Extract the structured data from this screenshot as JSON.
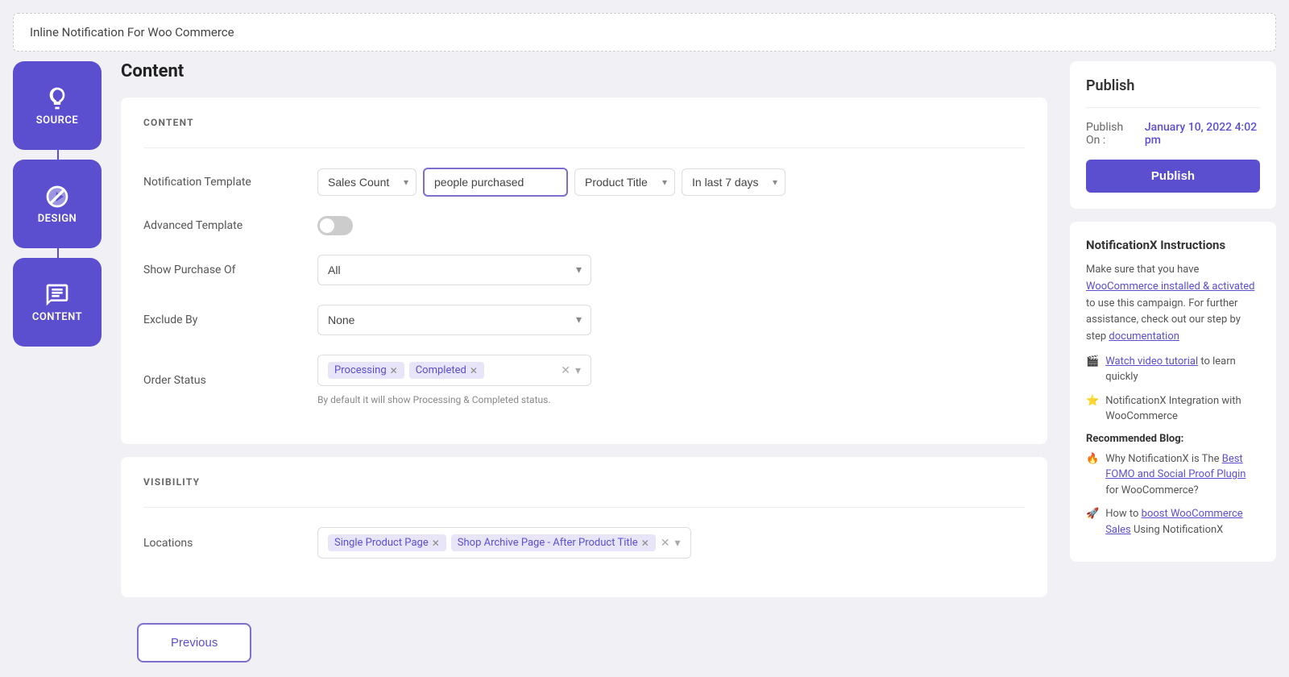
{
  "titleBar": {
    "text": "Inline Notification For Woo Commerce"
  },
  "sidebar": {
    "items": [
      {
        "id": "source",
        "label": "SOURCE",
        "icon": "source"
      },
      {
        "id": "design",
        "label": "DESIGN",
        "icon": "design"
      },
      {
        "id": "content",
        "label": "CONTENT",
        "icon": "content",
        "active": true
      }
    ]
  },
  "mainContent": {
    "pageTitle": "Content",
    "sections": [
      {
        "id": "content",
        "heading": "CONTENT",
        "fields": [
          {
            "id": "notification-template",
            "label": "Notification Template",
            "type": "multi-select-row"
          },
          {
            "id": "advanced-template",
            "label": "Advanced Template",
            "type": "toggle"
          },
          {
            "id": "show-purchase-of",
            "label": "Show Purchase Of",
            "type": "select",
            "value": "All"
          },
          {
            "id": "exclude-by",
            "label": "Exclude By",
            "type": "select",
            "value": "None"
          },
          {
            "id": "order-status",
            "label": "Order Status",
            "type": "tags",
            "tags": [
              "Processing",
              "Completed"
            ],
            "hint": "By default it will show Processing & Completed status."
          }
        ]
      },
      {
        "id": "visibility",
        "heading": "VISIBILITY",
        "fields": [
          {
            "id": "locations",
            "label": "Locations",
            "type": "tags",
            "tags": [
              "Single Product Page",
              "Shop Archive Page - After Product Title"
            ]
          }
        ]
      }
    ]
  },
  "notificationTemplate": {
    "salesCountOption": "Sales Count",
    "textInput": "people purchased",
    "productTitleOption": "Product Title",
    "timeRangeOption": "In last 7 days"
  },
  "bottomBar": {
    "previousLabel": "Previous"
  },
  "rightPanel": {
    "publishTitle": "Publish",
    "publishOnLabel": "Publish On :",
    "publishDate": "January 10, 2022 4:02 pm",
    "publishButtonLabel": "Publish",
    "instructionsTitle": "NotificationX Instructions",
    "instructionText1": "Make sure that you have",
    "instructionLink1": "WooCommerce installed & activated",
    "instructionText2": "to use this campaign. For further assistance, check out our step by step",
    "instructionLink2": "documentation",
    "videoText": "to learn quickly",
    "videoLink": "Watch video tutorial",
    "integrationText": "NotificationX Integration with WooCommerce",
    "recommendedLabel": "Recommended Blog:",
    "blog1Text1": "Why NotificationX is The",
    "blog1Link": "Best FOMO and Social Proof Plugin",
    "blog1Text2": "for WooCommerce?",
    "blog2Text1": "How to",
    "blog2Link": "boost WooCommerce Sales",
    "blog2Text2": "Using NotificationX"
  }
}
